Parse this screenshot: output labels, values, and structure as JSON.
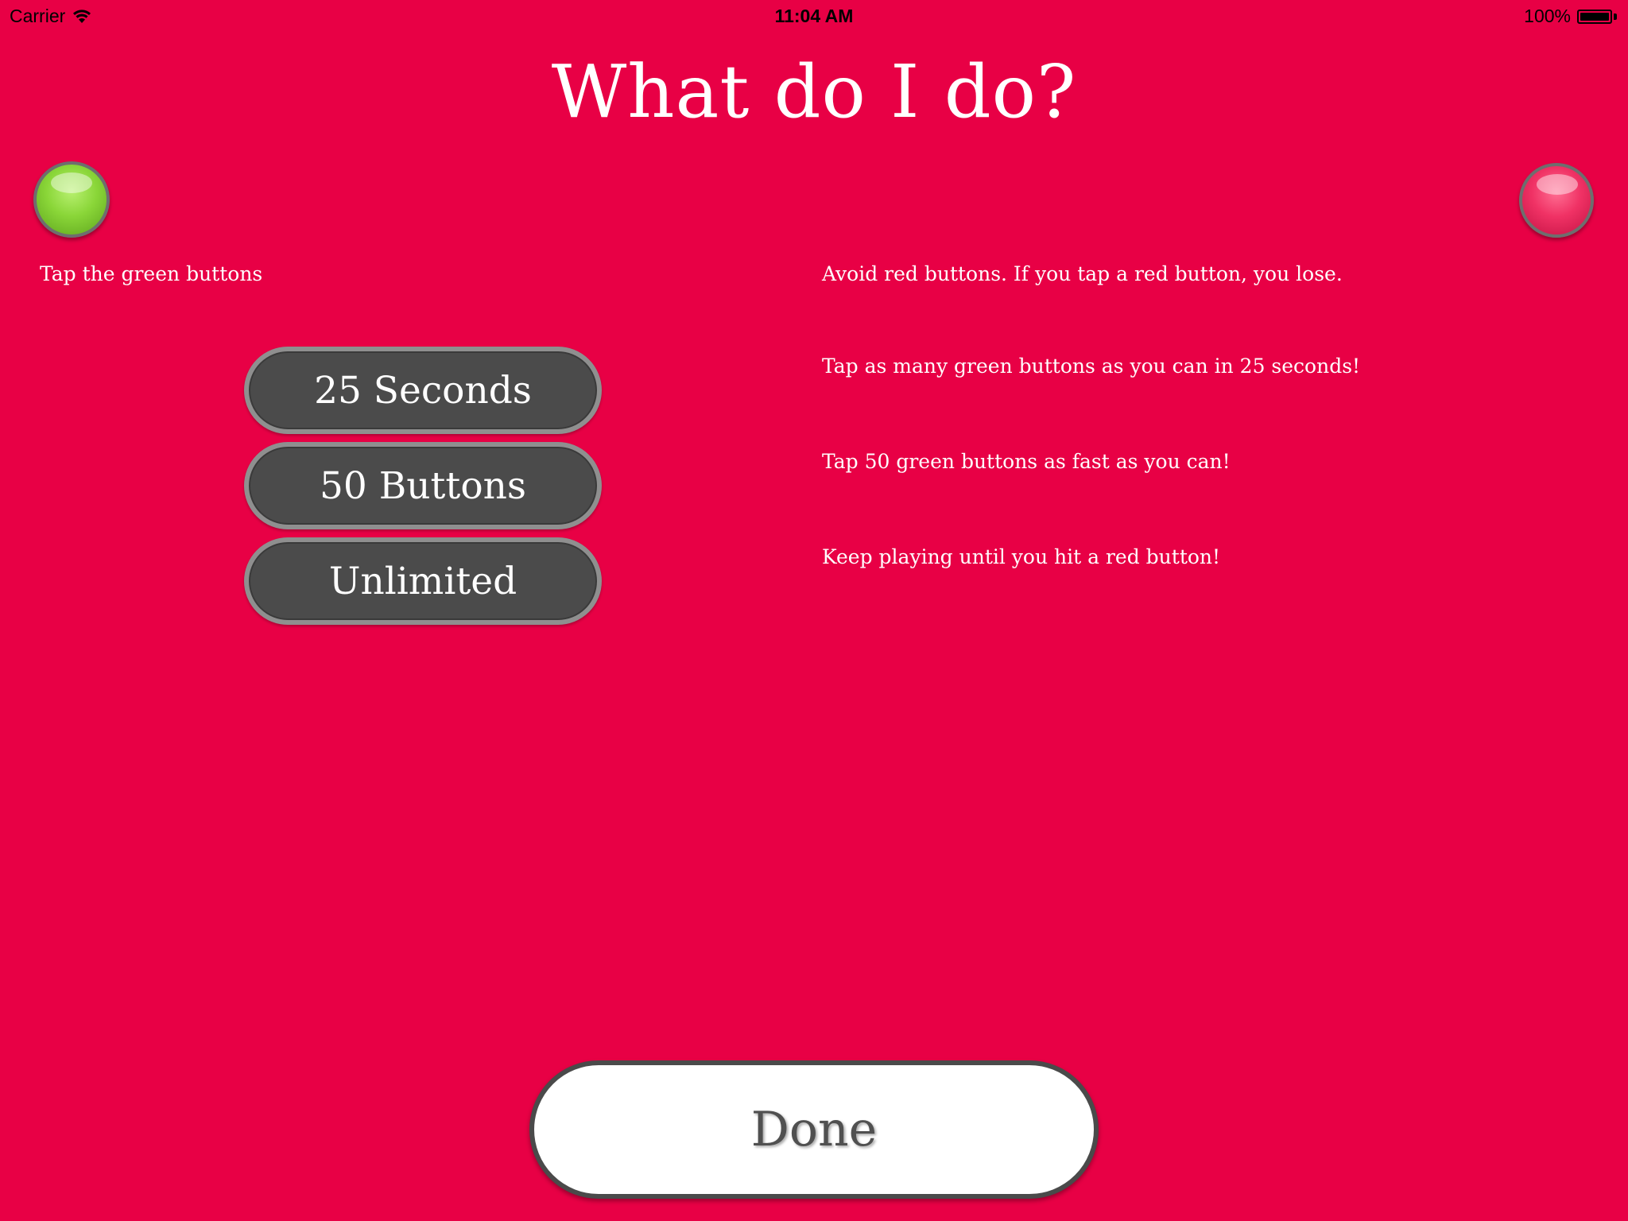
{
  "status_bar": {
    "carrier": "Carrier",
    "time": "11:04 AM",
    "battery_percent": "100%",
    "battery_level": 1.0
  },
  "title": "What do I do?",
  "icons": {
    "wifi": "wifi-icon",
    "battery": "battery-icon",
    "green_orb": "green-button-icon",
    "red_orb": "red-button-icon"
  },
  "colors": {
    "background": "#e80045",
    "green_orb": "#8ad638",
    "red_orb": "#f03265",
    "mode_button": "#4b4b4b",
    "done_button": "#ffffff"
  },
  "instructions": {
    "green": "Tap the green buttons",
    "red": "Avoid red buttons. If you tap a red button, you lose."
  },
  "modes": [
    {
      "label": "25 Seconds",
      "description": "Tap as many green buttons as you can in 25 seconds!"
    },
    {
      "label": "50 Buttons",
      "description": "Tap 50 green buttons as fast as you can!"
    },
    {
      "label": "Unlimited",
      "description": "Keep playing until you hit a red button!"
    }
  ],
  "done_label": "Done"
}
